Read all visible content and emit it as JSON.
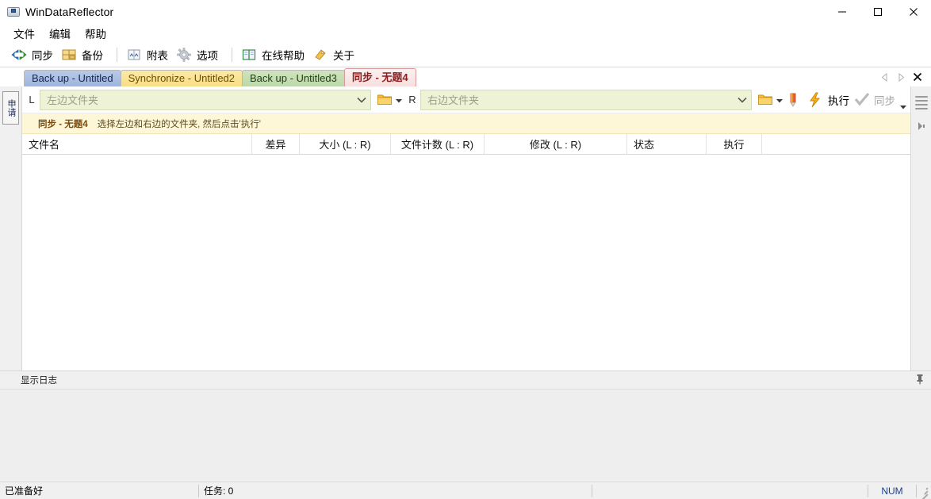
{
  "window": {
    "title": "WinDataReflector",
    "icon": "app-drive-icon",
    "minimize_label": "—",
    "maximize_label": "□",
    "close_label": "✕"
  },
  "menubar": {
    "items": [
      {
        "label": "文件"
      },
      {
        "label": "编辑"
      },
      {
        "label": "帮助"
      }
    ]
  },
  "toolbar": {
    "items": [
      {
        "label": "同步",
        "icon": "sync-arrows-icon"
      },
      {
        "label": "备份",
        "icon": "backup-grid-icon"
      },
      {
        "label": "附表",
        "icon": "schedule-icon"
      },
      {
        "label": "选项",
        "icon": "gear-icon"
      },
      {
        "label": "在线帮助",
        "icon": "book-icon"
      },
      {
        "label": "关于",
        "icon": "tag-icon"
      }
    ]
  },
  "tabs": {
    "items": [
      {
        "label": "Back up - Untitled",
        "color": "blue",
        "active": false
      },
      {
        "label": "Synchronize - Untitled2",
        "color": "yellow",
        "active": false
      },
      {
        "label": "Back up - Untitled3",
        "color": "green",
        "active": false
      },
      {
        "label": "同步 - 无题4",
        "color": "active",
        "active": true
      }
    ],
    "scroll_left": "◁",
    "scroll_right": "▷",
    "close_label": "✖"
  },
  "left_rail": {
    "vertical_tab_label": "申请"
  },
  "pathbar": {
    "left_side_label": "L",
    "left_placeholder": "左边文件夹",
    "left_value": "",
    "right_side_label": "R",
    "right_placeholder": "右边文件夹",
    "right_value": "",
    "browse_icon": "folder-icon",
    "browse_caret": "▾",
    "bookmark_icon": "pencil-icon",
    "execute_label": "执行",
    "execute_icon": "lightning-icon",
    "sync_label": "同步",
    "sync_icon": "check-icon",
    "overflow_caret": "▾"
  },
  "infobar": {
    "task_name": "同步 - 无题4",
    "hint": "选择左边和右边的文件夹, 然后点击'执行'"
  },
  "filelist": {
    "columns": [
      {
        "label": "文件名"
      },
      {
        "label": "差异"
      },
      {
        "label": "大小 (L : R)"
      },
      {
        "label": "文件计数 (L : R)"
      },
      {
        "label": "修改 (L : R)"
      },
      {
        "label": "状态"
      },
      {
        "label": "执行"
      }
    ],
    "rows": []
  },
  "right_rail": {
    "menu_icon": "lines-icon",
    "expand_icon": "expand-arrow-icon"
  },
  "logpanel": {
    "title": "显示日志",
    "pin_icon": "pushpin-icon",
    "content": ""
  },
  "statusbar": {
    "ready": "已准备好",
    "task": "任务: 0",
    "num": "NUM"
  },
  "colors": {
    "combo_bg": "#eef3d5",
    "infobar_bg": "#fdf7d8",
    "active_tab_text": "#8c1c1c",
    "tab_blue": "#aabfe4",
    "tab_yellow": "#f8e092",
    "tab_green": "#c4dcb1",
    "accent_pink": "#f0a8ae"
  }
}
